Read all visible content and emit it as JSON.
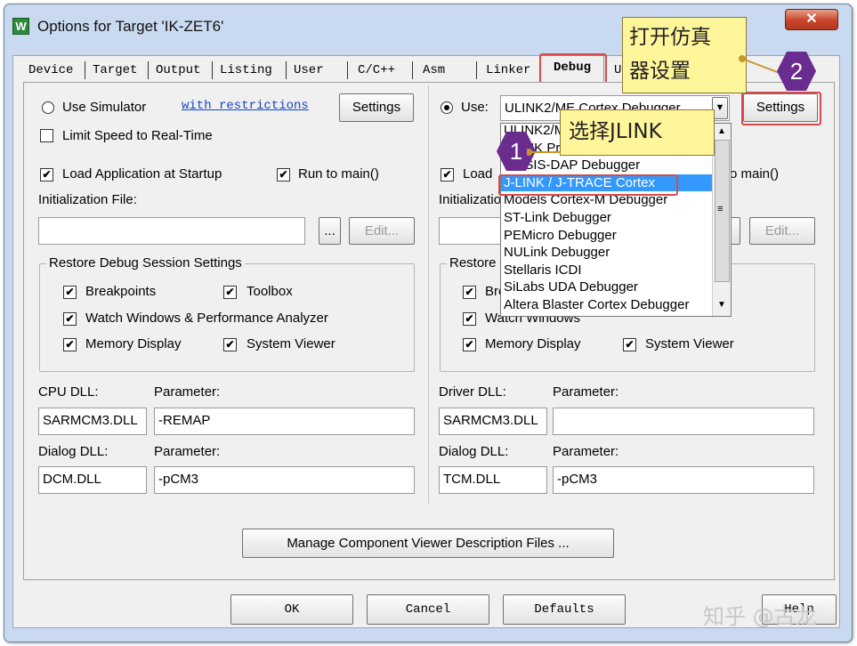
{
  "window": {
    "title": "Options for Target 'IK-ZET6'",
    "close_glyph": "✕",
    "app_icon_glyph": "W"
  },
  "tabs": [
    {
      "label": "Device"
    },
    {
      "label": "Target"
    },
    {
      "label": "Output"
    },
    {
      "label": "Listing"
    },
    {
      "label": "User"
    },
    {
      "label": "C/C++"
    },
    {
      "label": "Asm"
    },
    {
      "label": "Linker"
    },
    {
      "label": "Debug",
      "active": true
    },
    {
      "label": "U"
    }
  ],
  "left": {
    "use_simulator": {
      "label": "Use Simulator",
      "checked": false
    },
    "restrictions_link": "with restrictions",
    "settings_button": "Settings",
    "limit_speed": {
      "label": "Limit Speed to Real-Time",
      "checked": false
    },
    "load_app": {
      "label": "Load Application at Startup",
      "checked": true
    },
    "run_to_main": {
      "label": "Run to main()",
      "checked": true
    },
    "init_file_label": "Initialization File:",
    "browse_button": "...",
    "edit_button": "Edit...",
    "restore_group": "Restore Debug Session Settings",
    "breakpoints": {
      "label": "Breakpoints",
      "checked": true
    },
    "toolbox": {
      "label": "Toolbox",
      "checked": true
    },
    "watch_windows": {
      "label": "Watch Windows & Performance Analyzer",
      "checked": true
    },
    "memory_display": {
      "label": "Memory Display",
      "checked": true
    },
    "system_viewer": {
      "label": "System Viewer",
      "checked": true
    },
    "cpu_dll_label": "CPU DLL:",
    "cpu_param_label": "Parameter:",
    "cpu_dll": "SARMCM3.DLL",
    "cpu_param": "-REMAP",
    "dialog_dll_label": "Dialog DLL:",
    "dialog_param_label": "Parameter:",
    "dialog_dll": "DCM.DLL",
    "dialog_param": "-pCM3"
  },
  "right": {
    "use": {
      "label": "Use:",
      "checked": true
    },
    "debugger_select": "ULINK2/ME Cortex Debugger",
    "settings_button": "Settings",
    "load_partial": "Load",
    "run_to_main_partial": "o main()",
    "init_partial": "Initializatio",
    "edit_button": "Edit...",
    "restore_partial": "Restore",
    "breakpoints_partial": "Bre",
    "watch_windows": "Watch Windows",
    "memory_display": "Memory Display",
    "system_viewer": "System Viewer",
    "driver_dll_label": "Driver DLL:",
    "driver_param_label": "Parameter:",
    "driver_dll": "SARMCM3.DLL",
    "driver_param": "",
    "dialog_dll_label": "Dialog DLL:",
    "dialog_param_label": "Parameter:",
    "dialog_dll": "TCM.DLL",
    "dialog_param": "-pCM3"
  },
  "dropdown_items": [
    "ULINK2/ME Cortex Debugger",
    "ULINK Pro Cortex Debugger",
    "CMSIS-DAP Debugger",
    "J-LINK / J-TRACE Cortex",
    "Models Cortex-M Debugger",
    "ST-Link Debugger",
    "PEMicro Debugger",
    "NULink Debugger",
    "Stellaris ICDI",
    "SiLabs UDA Debugger",
    "Altera Blaster Cortex Debugger"
  ],
  "manage_button": "Manage Component Viewer Description Files ...",
  "footer": {
    "ok": "OK",
    "cancel": "Cancel",
    "defaults": "Defaults",
    "help_partial": "Help"
  },
  "annotations": {
    "callout_settings": "打开仿真\n器设置",
    "callout_jlink": "选择JLINK",
    "step1": "1",
    "step2": "2"
  },
  "watermark": "知乎 @古龙",
  "colors": {
    "selection": "#3399ff",
    "callout": "#fff59a",
    "step_badge": "#6a2c8e",
    "highlight_box": "#d84a4a"
  }
}
